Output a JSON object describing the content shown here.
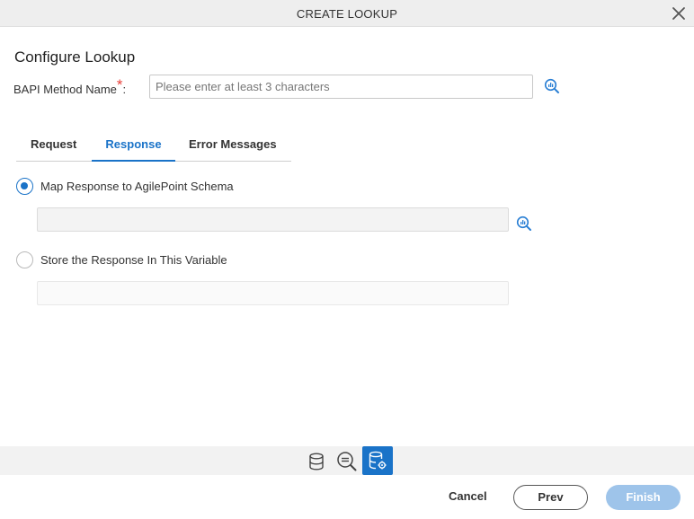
{
  "dialog": {
    "title": "CREATE LOOKUP"
  },
  "section": {
    "title": "Configure Lookup"
  },
  "bapi": {
    "label": "BAPI Method Name",
    "required_mark": "*",
    "colon": ":",
    "placeholder": "Please enter at least 3 characters",
    "value": ""
  },
  "tabs": [
    {
      "label": "Request",
      "active": false
    },
    {
      "label": "Response",
      "active": true
    },
    {
      "label": "Error Messages",
      "active": false
    }
  ],
  "response": {
    "option_map": {
      "label": "Map Response to AgilePoint Schema",
      "selected": true
    },
    "option_store": {
      "label": "Store the Response In This Variable",
      "selected": false
    }
  },
  "footer": {
    "cancel": "Cancel",
    "prev": "Prev",
    "finish": "Finish"
  },
  "icons": {
    "close": "close-icon",
    "lookup": "search-chart-icon",
    "database": "database-icon",
    "query": "query-icon",
    "database_settings": "database-settings-icon"
  },
  "colors": {
    "accent": "#1a73c8",
    "required": "#e8403a",
    "finish_disabled": "#9ec4ea"
  }
}
